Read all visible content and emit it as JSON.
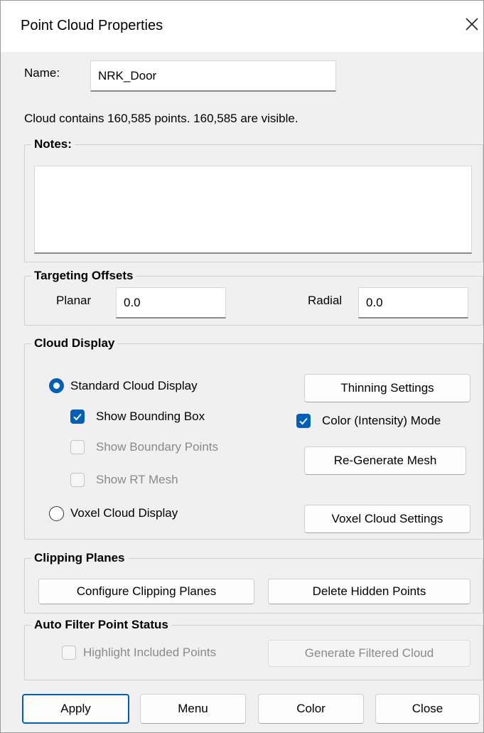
{
  "window": {
    "title": "Point Cloud Properties"
  },
  "name": {
    "label": "Name:",
    "value": "NRK_Door"
  },
  "cloud_info": "Cloud contains 160,585 points.  160,585 are visible.",
  "notes": {
    "title": "Notes:",
    "value": ""
  },
  "targeting": {
    "title": "Targeting Offsets",
    "planar_label": "Planar",
    "planar_value": "0.0",
    "radial_label": "Radial",
    "radial_value": "0.0"
  },
  "cloud_display": {
    "title": "Cloud Display",
    "standard_label": "Standard Cloud Display",
    "standard_selected": true,
    "show_bounding_box": {
      "label": "Show Bounding Box",
      "checked": true
    },
    "show_boundary_points": {
      "label": "Show Boundary Points",
      "checked": false,
      "enabled": false
    },
    "show_rt_mesh": {
      "label": "Show RT Mesh",
      "checked": false,
      "enabled": false
    },
    "voxel_label": "Voxel Cloud Display",
    "voxel_selected": false,
    "thinning_button": "Thinning Settings",
    "color_mode": {
      "label": "Color (Intensity) Mode",
      "checked": true
    },
    "regenerate_button": "Re-Generate Mesh",
    "voxel_settings_button": "Voxel Cloud Settings"
  },
  "clipping": {
    "title": "Clipping Planes",
    "configure_button": "Configure Clipping Planes",
    "delete_button": "Delete Hidden Points"
  },
  "auto_filter": {
    "title": "Auto Filter Point Status",
    "highlight": {
      "label": "Highlight Included Points",
      "checked": false,
      "enabled": false
    },
    "generate_button": "Generate Filtered Cloud"
  },
  "footer": {
    "apply": "Apply",
    "menu": "Menu",
    "color": "Color",
    "close": "Close"
  },
  "colors": {
    "accent": "#005fb8",
    "dialog_bg": "#f0f0f0",
    "disabled_text": "#8a8a8a"
  },
  "icons": {
    "close": "close-icon",
    "check": "checkmark-icon"
  }
}
